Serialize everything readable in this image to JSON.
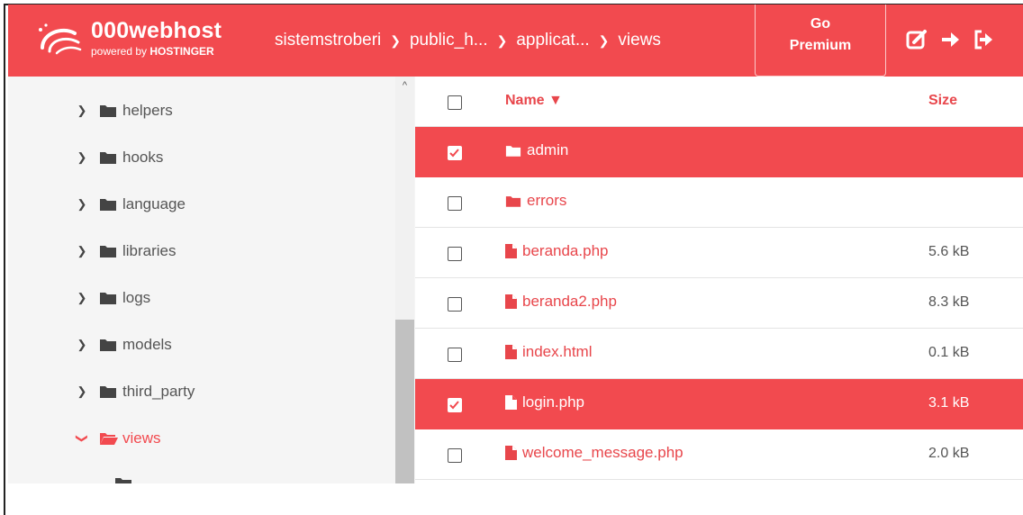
{
  "header": {
    "brand_name": "000webhost",
    "brand_sub_prefix": "powered by ",
    "brand_sub_strong": "HOSTINGER",
    "breadcrumbs": [
      "sistemstroberi",
      "public_h...",
      "applicat...",
      "views"
    ],
    "premium_line1": "Go",
    "premium_line2": "Premium",
    "icons": [
      "edit-icon",
      "arrow-right-icon",
      "logout-icon"
    ],
    "bg_color": "#f24a4f"
  },
  "sidebar": {
    "items": [
      {
        "label": "helpers",
        "expanded": false,
        "active": false
      },
      {
        "label": "hooks",
        "expanded": false,
        "active": false
      },
      {
        "label": "language",
        "expanded": false,
        "active": false
      },
      {
        "label": "libraries",
        "expanded": false,
        "active": false
      },
      {
        "label": "logs",
        "expanded": false,
        "active": false
      },
      {
        "label": "models",
        "expanded": false,
        "active": false
      },
      {
        "label": "third_party",
        "expanded": false,
        "active": false
      },
      {
        "label": "views",
        "expanded": true,
        "active": true
      }
    ]
  },
  "files": {
    "columns": {
      "name": "Name ▼",
      "size": "Size"
    },
    "rows": [
      {
        "name": "admin",
        "type": "folder",
        "size": "",
        "selected": true
      },
      {
        "name": "errors",
        "type": "folder",
        "size": "",
        "selected": false
      },
      {
        "name": "beranda.php",
        "type": "file",
        "size": "5.6 kB",
        "selected": false
      },
      {
        "name": "beranda2.php",
        "type": "file",
        "size": "8.3 kB",
        "selected": false
      },
      {
        "name": "index.html",
        "type": "file",
        "size": "0.1 kB",
        "selected": false
      },
      {
        "name": "login.php",
        "type": "file",
        "size": "3.1 kB",
        "selected": true
      },
      {
        "name": "welcome_message.php",
        "type": "file",
        "size": "2.0 kB",
        "selected": false
      }
    ]
  }
}
